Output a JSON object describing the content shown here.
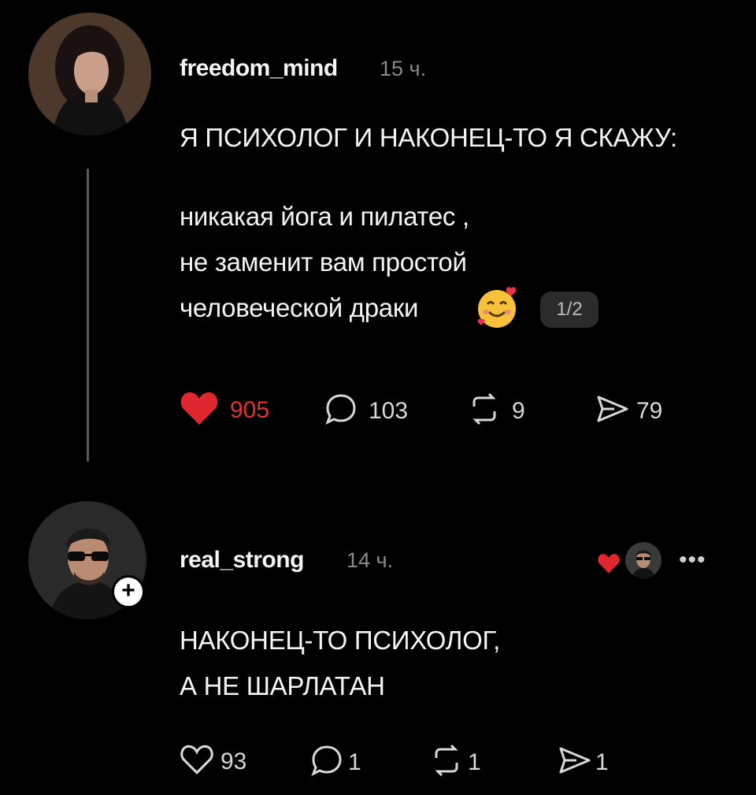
{
  "post": {
    "username": "freedom_mind",
    "time": "15 ч.",
    "headline": "Я ПСИХОЛОГ И НАКОНЕЦ-ТО Я СКАЖУ:",
    "body_lines": [
      "никакая йога и пилатес ,",
      "не заменит вам простой",
      "человеческой драки"
    ],
    "emoji": "smiling-face-with-hearts-icon",
    "page_indicator": "1/2",
    "likes": "905",
    "comments": "103",
    "reposts": "9",
    "shares": "79",
    "like_color": "#e0262f"
  },
  "reply": {
    "username": "real_strong",
    "time": "14 ч.",
    "lines": [
      "НАКОНЕЦ-ТО ПСИХОЛОГ,",
      "А НЕ ШАРЛАТАН"
    ],
    "likes": "93",
    "comments": "1",
    "reposts": "1",
    "shares": "1",
    "add_symbol": "+",
    "more_symbol": "•••",
    "liked_by_author_color": "#e0262f"
  }
}
